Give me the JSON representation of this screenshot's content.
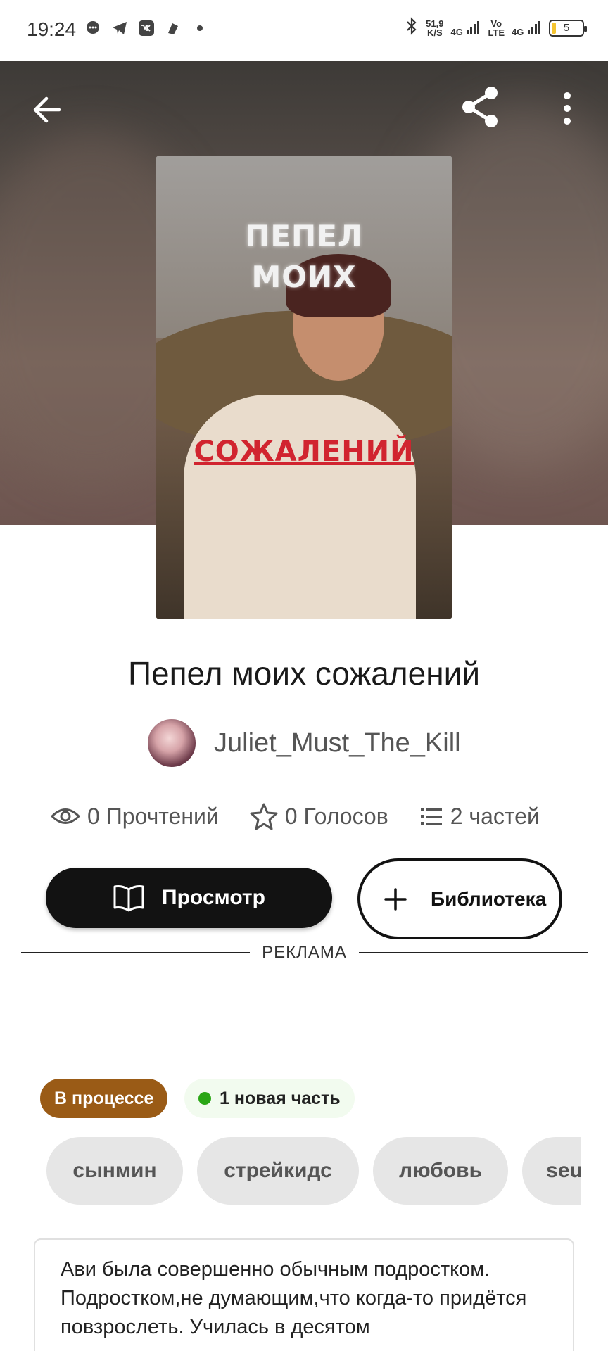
{
  "status_bar": {
    "time": "19:24",
    "net_speed": "51,9",
    "net_unit": "K/S",
    "net1": "4G",
    "volte_top": "Vo",
    "volte_bottom": "LTE",
    "net2": "4G",
    "battery": "5",
    "icons": [
      "chat-bubble-icon",
      "telegram-icon",
      "vk-icon",
      "notification-icon",
      "dot-icon",
      "bluetooth-icon",
      "signal-icon"
    ]
  },
  "header": {
    "back_icon": "arrow-left-icon",
    "share_icon": "share-icon",
    "more_icon": "more-vertical-icon"
  },
  "cover": {
    "line1": "ПЕПЕЛ",
    "line2": "МОИХ",
    "line3": "СОЖАЛЕНИЙ"
  },
  "story": {
    "title": "Пепел моих сожалений",
    "author": "Juliet_Must_The_Kill"
  },
  "stats": {
    "reads": "0 Прочтений",
    "votes": "0 Голосов",
    "parts": "2 частей"
  },
  "actions": {
    "read_label": "Просмотр",
    "library_label": "Библиотека"
  },
  "ad": {
    "label": "РЕКЛАМА"
  },
  "status": {
    "progress": "В процессе",
    "new_part": "1 новая часть"
  },
  "tags": [
    "сынмин",
    "стрейкидс",
    "любовь",
    "seungmin"
  ],
  "description": "Ави была совершенно обычным подростком. Подростком,не думающим,что когда-то придётся повзрослеть. Училась в десятом",
  "colors": {
    "progress_chip": "#9a5b16",
    "new_dot": "#2aa615",
    "primary_button": "#121212",
    "cover_accent": "#d1242f"
  }
}
